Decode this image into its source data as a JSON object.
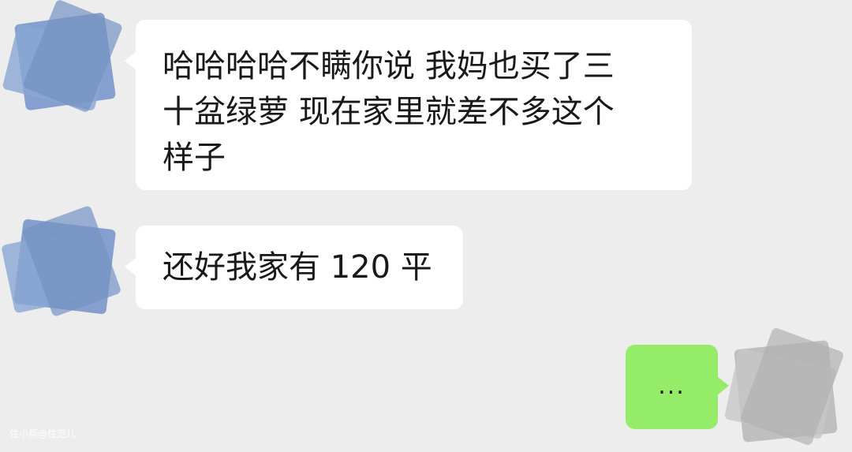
{
  "chat": {
    "messages": [
      {
        "sender": "other",
        "text": "哈哈哈哈不瞒你说 我妈也买了三\n十盆绿萝 现在家里就差不多这个\n样子"
      },
      {
        "sender": "other",
        "text": "还好我家有 120 平"
      },
      {
        "sender": "self",
        "text": "..."
      }
    ]
  },
  "watermark": {
    "text": "住小帮@住范儿"
  },
  "colors": {
    "background": "#ededed",
    "other_bubble": "#ffffff",
    "self_bubble": "#95ec69",
    "text": "#191919",
    "avatar_other": "#7f9ccc",
    "avatar_self": "#b9b9b9"
  }
}
